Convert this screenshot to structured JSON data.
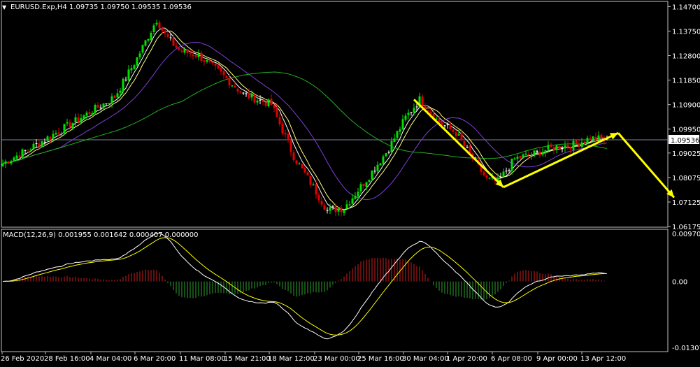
{
  "window": {
    "symbol_header": "EURUSD.Exp,H4  1.09735 1.09750 1.09535 1.09536",
    "corner_marker": "▼"
  },
  "colors": {
    "background": "#000000",
    "frame": "#bfbfbf",
    "bull_candle": "#00e000",
    "bear_candle": "#e00000",
    "doji": "#ffffff",
    "ma_fast": "#ffffff",
    "ma_mid": "#ffff80",
    "ma_slow": "#7f3fd6",
    "ma_long": "#22b022",
    "macd_line": "#ffffff",
    "signal_line": "#ffff00",
    "hist_pos": "#cc1e1e",
    "hist_neg": "#2ea02e",
    "arrow": "#ffff00",
    "bid_line": "#7f7fa0"
  },
  "chart_data": [
    {
      "type": "candlestick",
      "timeframe": "H4",
      "current_price_label": "1.09536",
      "current_price": 1.09536,
      "y_ticks": [
        "1.14700",
        "1.13750",
        "1.12800",
        "1.11850",
        "1.10900",
        "1.09950",
        "1.09025",
        "1.08075",
        "1.07125",
        "1.06175"
      ],
      "ylim": [
        1.0615,
        1.149
      ],
      "x_tick_labels": [
        "26 Feb 2020",
        "28 Feb 16:00",
        "4 Mar 04:00",
        "6 Mar 20:00",
        "11 Mar 08:00",
        "15 Mar 21:00",
        "18 Mar 12:00",
        "23 Mar 00:00",
        "25 Mar 16:00",
        "30 Mar 04:00",
        "1 Apr 20:00",
        "6 Apr 08:00",
        "9 Apr 00:00",
        "13 Apr 12:00"
      ],
      "close_anchors": [
        [
          0,
          1.0862
        ],
        [
          12,
          1.0935
        ],
        [
          25,
          1.102
        ],
        [
          40,
          1.112
        ],
        [
          48,
          1.127
        ],
        [
          55,
          1.142
        ],
        [
          58,
          1.136
        ],
        [
          63,
          1.13
        ],
        [
          70,
          1.128
        ],
        [
          78,
          1.121
        ],
        [
          86,
          1.113
        ],
        [
          96,
          1.109
        ],
        [
          104,
          1.089
        ],
        [
          111,
          1.077
        ],
        [
          116,
          1.068
        ],
        [
          122,
          1.069
        ],
        [
          130,
          1.08
        ],
        [
          138,
          1.092
        ],
        [
          144,
          1.104
        ],
        [
          149,
          1.111
        ],
        [
          156,
          1.102
        ],
        [
          162,
          1.098
        ],
        [
          168,
          1.088
        ],
        [
          173,
          1.08
        ],
        [
          177,
          1.079
        ],
        [
          183,
          1.088
        ],
        [
          190,
          1.09
        ],
        [
          197,
          1.0925
        ],
        [
          204,
          1.0935
        ],
        [
          210,
          1.096
        ],
        [
          216,
          1.0955
        ]
      ],
      "moving_average_periods": [
        5,
        8,
        21,
        65
      ],
      "arrows": [
        {
          "from": [
            147,
            1.111
          ],
          "to": [
            179,
            1.077
          ]
        },
        {
          "from": [
            179,
            1.077
          ],
          "to": [
            220,
            1.098
          ]
        },
        {
          "from": [
            220,
            1.098
          ],
          "to": [
            240,
            1.073
          ]
        }
      ]
    },
    {
      "type": "macd",
      "title": "MACD(12,26,9) 0.001955 0.001642 0.000407 0.000000",
      "fast": 12,
      "slow": 26,
      "signal": 9,
      "y_ticks": [
        "0.009709",
        "0.00",
        "-0.013074"
      ],
      "ylim": [
        -0.013074,
        0.009709
      ]
    }
  ]
}
